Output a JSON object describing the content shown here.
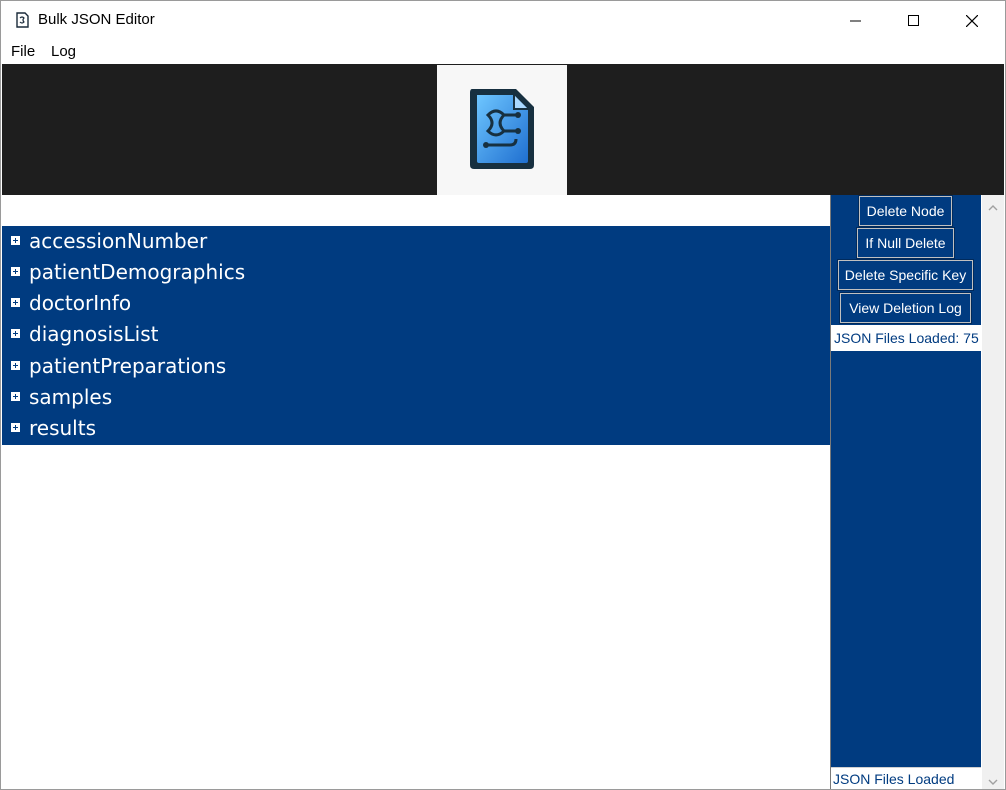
{
  "window": {
    "title": "Bulk JSON Editor",
    "controls": {
      "minimize": "minimize-icon",
      "maximize": "maximize-icon",
      "close": "close-icon"
    }
  },
  "menubar": {
    "items": [
      "File",
      "Log"
    ]
  },
  "banner": {
    "logo_icon": "json-file-circuit-logo"
  },
  "tree": {
    "filter_value": "",
    "nodes": [
      {
        "label": "accessionNumber",
        "expander": "plus-icon"
      },
      {
        "label": "patientDemographics",
        "expander": "plus-icon"
      },
      {
        "label": "doctorInfo",
        "expander": "plus-icon"
      },
      {
        "label": "diagnosisList",
        "expander": "plus-icon"
      },
      {
        "label": "patientPreparations",
        "expander": "plus-icon"
      },
      {
        "label": "samples",
        "expander": "plus-icon"
      },
      {
        "label": "results",
        "expander": "plus-icon"
      }
    ]
  },
  "actions": {
    "delete_node": "Delete Node",
    "if_null_delete": "If Null Delete",
    "delete_specific_key": "Delete Specific Key",
    "view_deletion_log": "View Deletion Log"
  },
  "status": {
    "files_loaded": "JSON Files Loaded: 75",
    "footer": "JSON Files Loaded"
  },
  "colors": {
    "accent": "#003b80",
    "banner": "#1e1e1e",
    "background": "#ffffff"
  }
}
